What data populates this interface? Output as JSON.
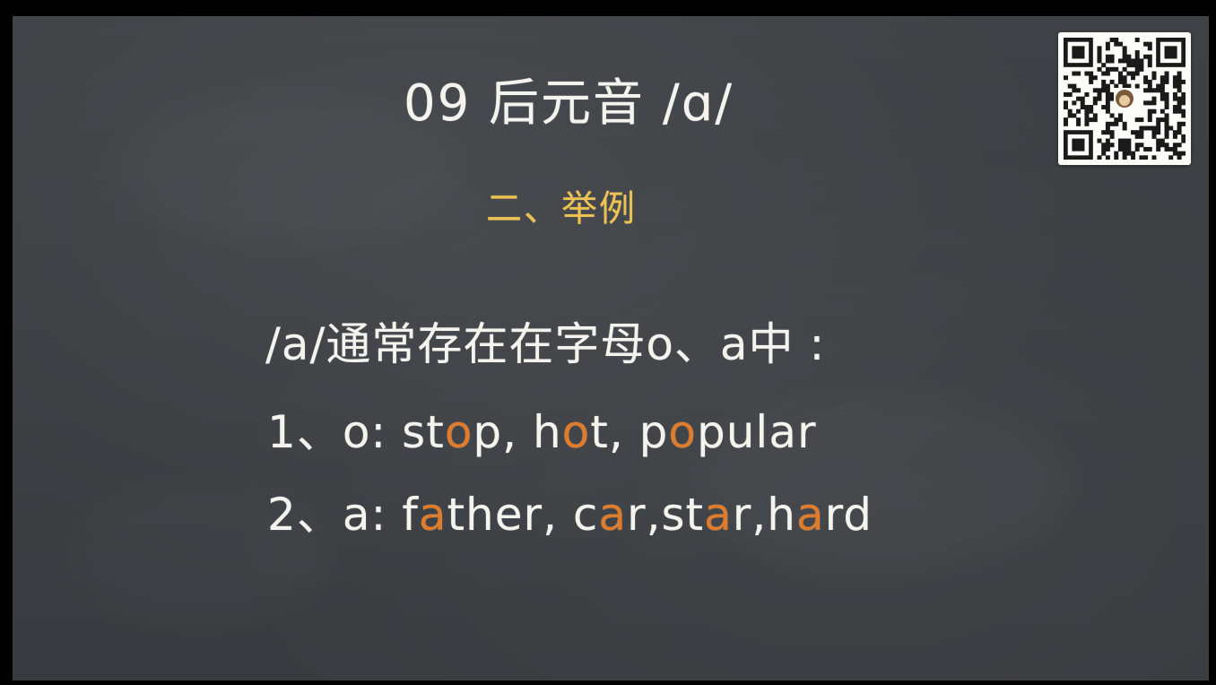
{
  "slide": {
    "title": "09 后元音 /ɑ/",
    "subtitle": "二、举例",
    "intro": "/a/通常存在在字母o、a中 :",
    "examples": [
      {
        "number": "1",
        "separator": "、",
        "letter": "o",
        "colon": ": ",
        "words": [
          {
            "before": "st",
            "highlight": "o",
            "after": "p",
            "trail": ", "
          },
          {
            "before": "h",
            "highlight": "o",
            "after": "t",
            "trail": ", "
          },
          {
            "before": "p",
            "highlight": "o",
            "after": "pular",
            "trail": ""
          }
        ]
      },
      {
        "number": "2",
        "separator": "、",
        "letter": "a",
        "colon": ": ",
        "words": [
          {
            "before": "f",
            "highlight": "a",
            "after": "ther",
            "trail": ", "
          },
          {
            "before": "c",
            "highlight": "a",
            "after": "r",
            "trail": ","
          },
          {
            "before": "st",
            "highlight": "a",
            "after": "r",
            "trail": ","
          },
          {
            "before": "h",
            "highlight": "a",
            "after": "rd",
            "trail": ""
          }
        ]
      }
    ],
    "qr_code": "qr-code-icon",
    "colors": {
      "board": "#3d4044",
      "chalk": "#f4f3ee",
      "subtitle": "#efc24f",
      "highlight": "#e07b2a"
    }
  }
}
